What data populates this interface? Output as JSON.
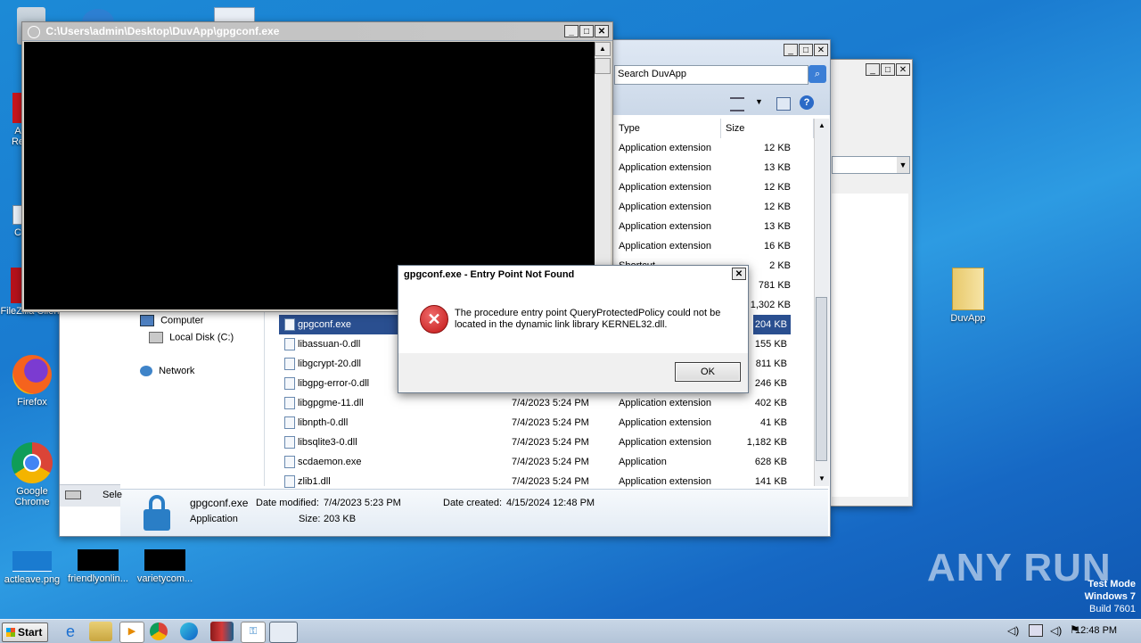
{
  "desktop": {
    "icons": [
      {
        "label": "Re"
      },
      {
        "label": "A"
      },
      {
        "label": "Re"
      },
      {
        "label": "C"
      },
      {
        "label": "FileZilla Client"
      },
      {
        "label": "Firefox"
      },
      {
        "label": "Google Chrome"
      },
      {
        "label": "DuvApp"
      },
      {
        "label": "actleave.png"
      },
      {
        "label": "friendlyonlin..."
      },
      {
        "label": "varietycom..."
      }
    ]
  },
  "cmd_window": {
    "title": "C:\\Users\\admin\\Desktop\\DuvApp\\gpgconf.exe"
  },
  "explorer": {
    "search_placeholder": "Search DuvApp",
    "columns": {
      "type": "Type",
      "size": "Size"
    },
    "top_rows": [
      {
        "type": "Application extension",
        "size": "12 KB"
      },
      {
        "type": "Application extension",
        "size": "13 KB"
      },
      {
        "type": "Application extension",
        "size": "12 KB"
      },
      {
        "type": "Application extension",
        "size": "12 KB"
      },
      {
        "type": "Application extension",
        "size": "13 KB"
      },
      {
        "type": "Application extension",
        "size": "16 KB"
      },
      {
        "type": "Shortcut",
        "size": "2 KB"
      },
      {
        "type": "",
        "size": "781 KB"
      },
      {
        "type": "",
        "size": "1,302 KB"
      }
    ],
    "nav": {
      "computer": "Computer",
      "local_disk": "Local Disk (C:)",
      "network": "Network"
    },
    "files": [
      {
        "name": "gpgconf.exe",
        "date": "",
        "type": "",
        "size": "204 KB",
        "selected": true
      },
      {
        "name": "libassuan-0.dll",
        "date": "",
        "type": "",
        "size": "155 KB"
      },
      {
        "name": "libgcrypt-20.dll",
        "date": "",
        "type": "",
        "size": "811 KB"
      },
      {
        "name": "libgpg-error-0.dll",
        "date": "",
        "type": "",
        "size": "246 KB"
      },
      {
        "name": "libgpgme-11.dll",
        "date": "7/4/2023 5:24 PM",
        "type": "Application extension",
        "size": "402 KB"
      },
      {
        "name": "libnpth-0.dll",
        "date": "7/4/2023 5:24 PM",
        "type": "Application extension",
        "size": "41 KB"
      },
      {
        "name": "libsqlite3-0.dll",
        "date": "7/4/2023 5:24 PM",
        "type": "Application extension",
        "size": "1,182 KB"
      },
      {
        "name": "scdaemon.exe",
        "date": "7/4/2023 5:24 PM",
        "type": "Application",
        "size": "628 KB"
      },
      {
        "name": "zlib1.dll",
        "date": "7/4/2023 5:24 PM",
        "type": "Application extension",
        "size": "141 KB"
      }
    ],
    "details": {
      "name": "gpgconf.exe",
      "date_modified_label": "Date modified:",
      "date_modified": "7/4/2023 5:23 PM",
      "date_created_label": "Date created:",
      "date_created": "4/15/2024 12:48 PM",
      "kind": "Application",
      "size_label": "Size:",
      "size": "203 KB"
    },
    "left_status": "Sele"
  },
  "dialog": {
    "title": "gpgconf.exe - Entry Point Not Found",
    "message_line1": "The procedure entry point QueryProtectedPolicy could not be",
    "message_line2": "located in the dynamic link library KERNEL32.dll.",
    "ok_label": "OK"
  },
  "taskbar": {
    "start_label": "Start",
    "clock": "12:48 PM"
  },
  "watermark": {
    "brand": "ANY RUN",
    "line1": "Test Mode",
    "line2": "Windows 7",
    "line3": "Build 7601"
  }
}
